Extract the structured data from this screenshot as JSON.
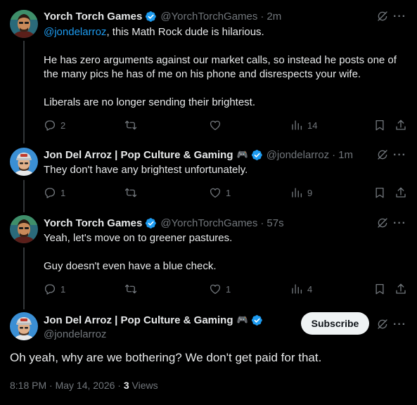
{
  "tweets": [
    {
      "name": "Yorch Torch Games",
      "handle": "@YorchTorchGames",
      "time": "2m",
      "mention": "@jondelarroz",
      "line1_rest": ", this Math Rock dude is hilarious.",
      "para2": "He has zero arguments against our market calls, so instead he posts one of the many pics he has of me on his phone and disrespects your wife.",
      "para3": "Liberals are no longer sending their brightest.",
      "replies": "2",
      "likes": "",
      "views": "14"
    },
    {
      "name": "Jon Del Arroz | Pop Culture & Gaming",
      "handle": "@jondelarroz",
      "time": "1m",
      "text": "They don't have any brightest unfortunately.",
      "replies": "1",
      "likes": "1",
      "views": "9"
    },
    {
      "name": "Yorch Torch Games",
      "handle": "@YorchTorchGames",
      "time": "57s",
      "para1": "Yeah, let's move on to greener pastures.",
      "para2": "Guy doesn't even have a blue check.",
      "replies": "1",
      "likes": "1",
      "views": "4"
    }
  ],
  "main": {
    "name": "Jon Del Arroz | Pop Culture & Gaming",
    "handle": "@jondelarroz",
    "subscribe_label": "Subscribe",
    "text": "Oh yeah, why are we bothering? We don't get paid for that.",
    "timestamp": "8:18 PM · May 14, 2026 · ",
    "views_count": "3",
    "views_label": "Views"
  },
  "icons": {
    "verified": "verified-badge-icon",
    "grok": "grok-icon",
    "more": "more-icon",
    "reply": "reply-icon",
    "retweet": "retweet-icon",
    "like": "like-icon",
    "views": "views-icon",
    "bookmark": "bookmark-icon",
    "share": "share-icon",
    "gamepad": "gamepad-icon"
  },
  "colors": {
    "background": "#000000",
    "text": "#e7e9ea",
    "muted": "#71767b",
    "accent": "#1d9bf0",
    "divider": "#333639"
  }
}
